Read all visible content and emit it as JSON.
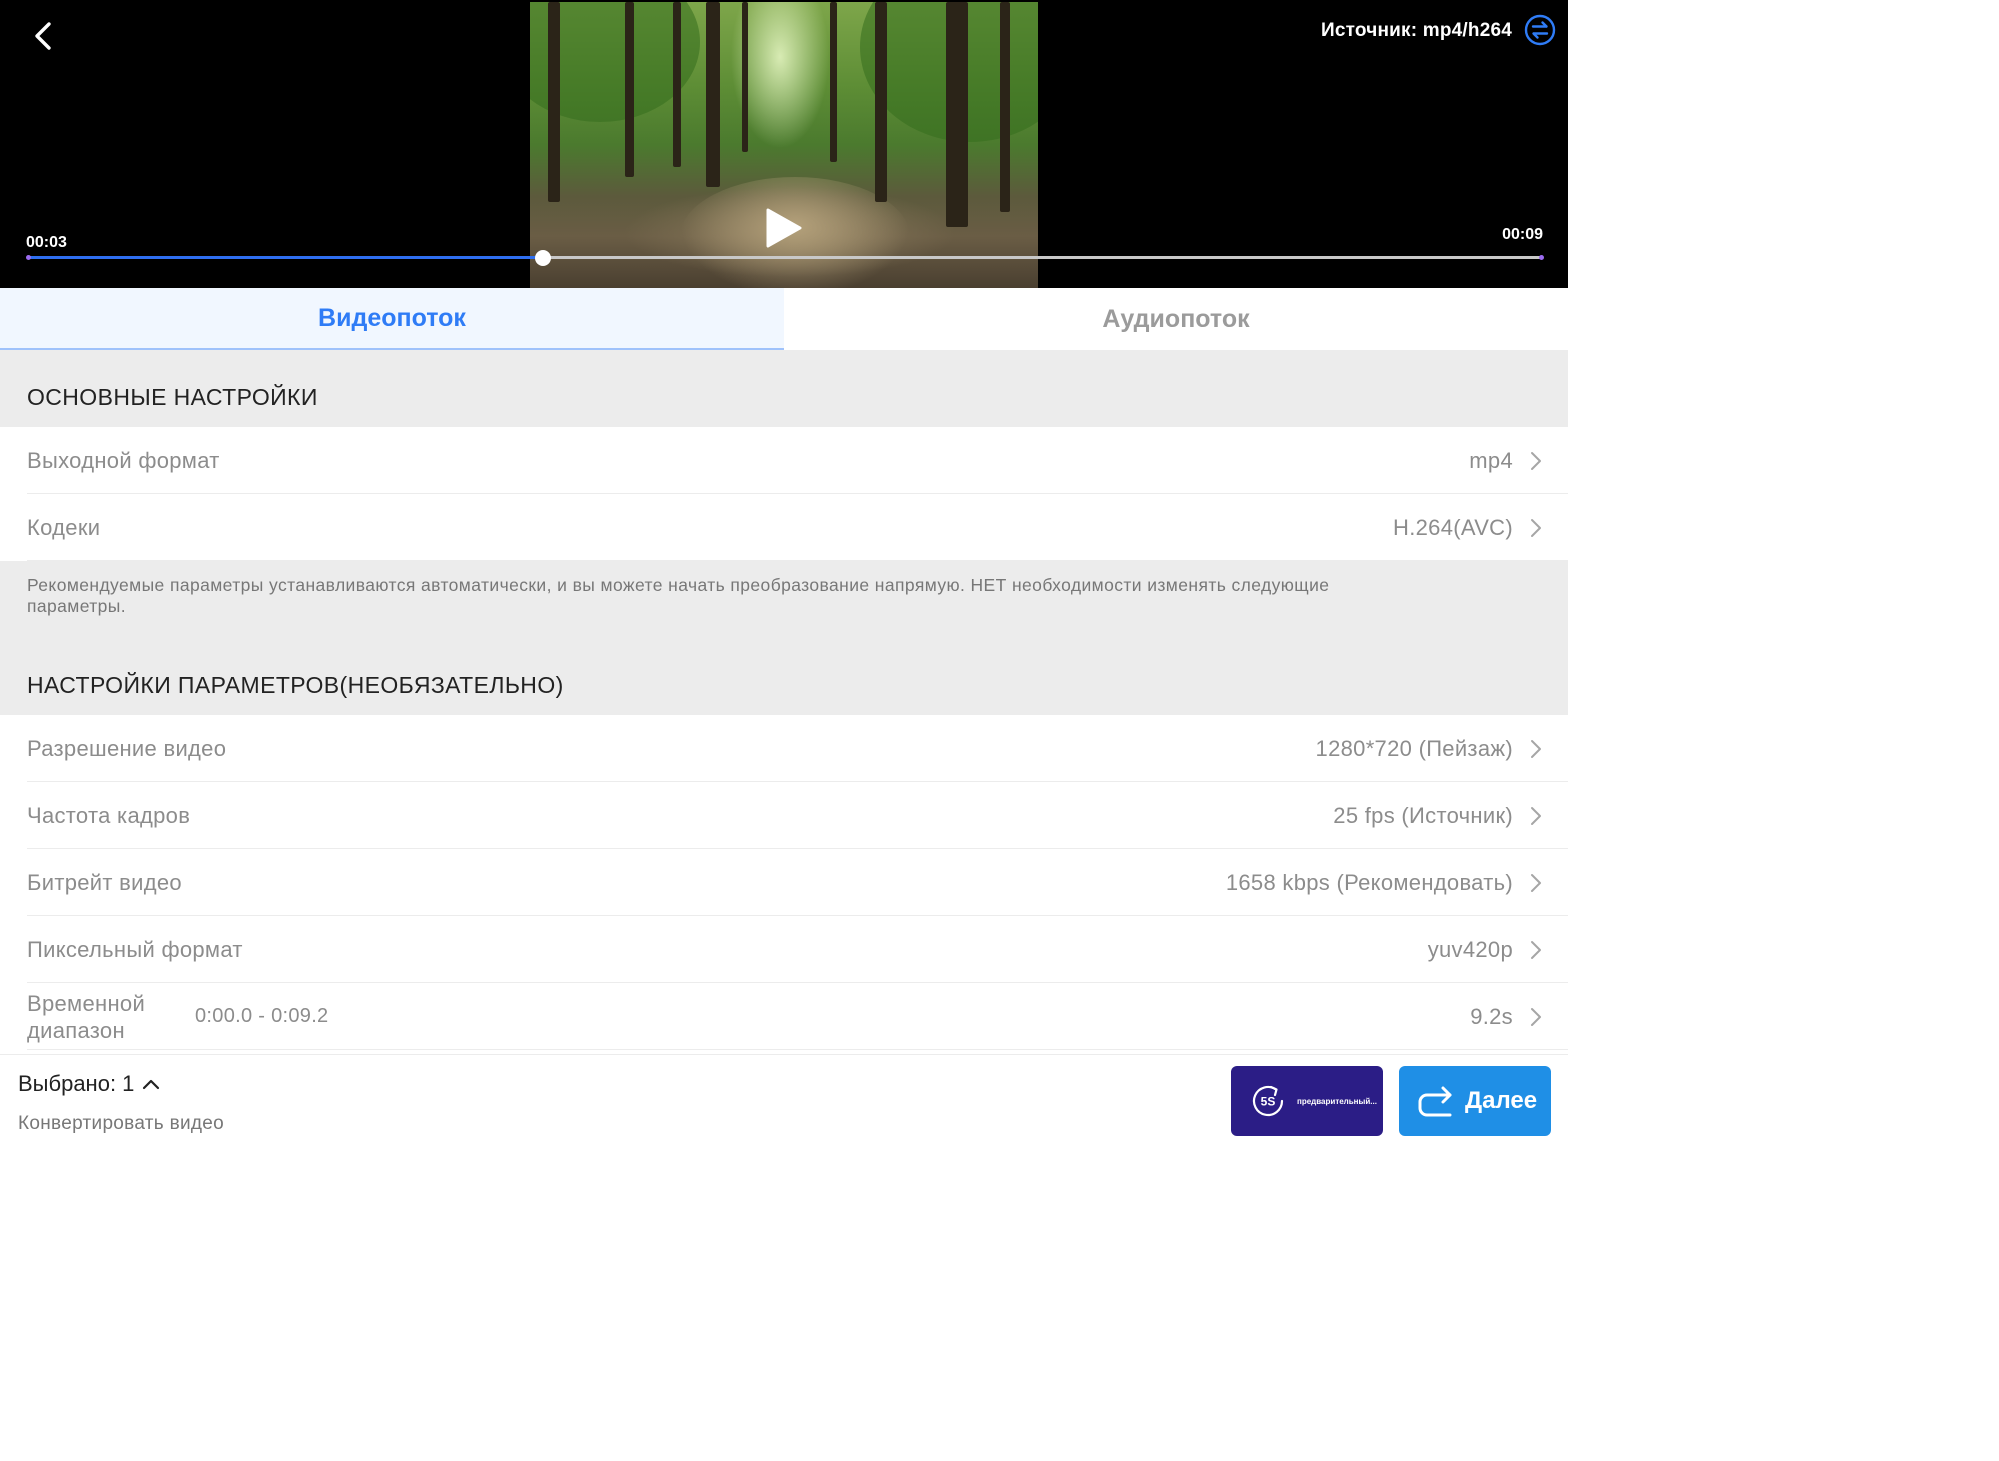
{
  "player": {
    "source_label": "Источник: mp4/h264",
    "time_current": "00:03",
    "time_total": "00:09",
    "progress_fraction": 0.34
  },
  "tabs": [
    {
      "label": "Видеопоток",
      "active": true
    },
    {
      "label": "Аудиопоток",
      "active": false
    }
  ],
  "basic": {
    "title": "ОСНОВНЫЕ НАСТРОЙКИ",
    "rows": [
      {
        "label": "Выходной формат",
        "value": "mp4"
      },
      {
        "label": "Кодеки",
        "value": "H.264(AVC)"
      }
    ]
  },
  "note": "Рекомендуемые параметры устанавливаются автоматически, и вы можете начать преобразование напрямую. НЕТ необходимости изменять следующие параметры.",
  "advanced": {
    "title": "НАСТРОЙКИ ПАРАМЕТРОВ(НЕОБЯЗАТЕЛЬНО)",
    "rows": [
      {
        "label": "Разрешение видео",
        "value": "1280*720 (Пейзаж)"
      },
      {
        "label": "Частота кадров",
        "value": "25 fps (Источник)"
      },
      {
        "label": "Битрейт видео",
        "value": "1658 kbps (Рекомендовать)"
      },
      {
        "label": "Пиксельный формат",
        "value": "yuv420p"
      }
    ],
    "time_range": {
      "label": "Временной диапазон",
      "range": "0:00.0 - 0:09.2",
      "value": "9.2s"
    }
  },
  "bottom": {
    "selected": "Выбрано: 1",
    "subtitle": "Конвертировать видео",
    "preview_badge": "5S",
    "preview_label": "предварительный...",
    "next_label": "Далее"
  },
  "colors": {
    "accent": "#2f7cf6",
    "preview_button": "#2b1d86",
    "next_button": "#1f8fe6"
  },
  "icons": [
    "back-arrow-icon",
    "swap-source-icon",
    "play-icon",
    "chevron-right-icon",
    "caret-up-icon",
    "preview-5s-icon",
    "redo-arrow-icon"
  ]
}
